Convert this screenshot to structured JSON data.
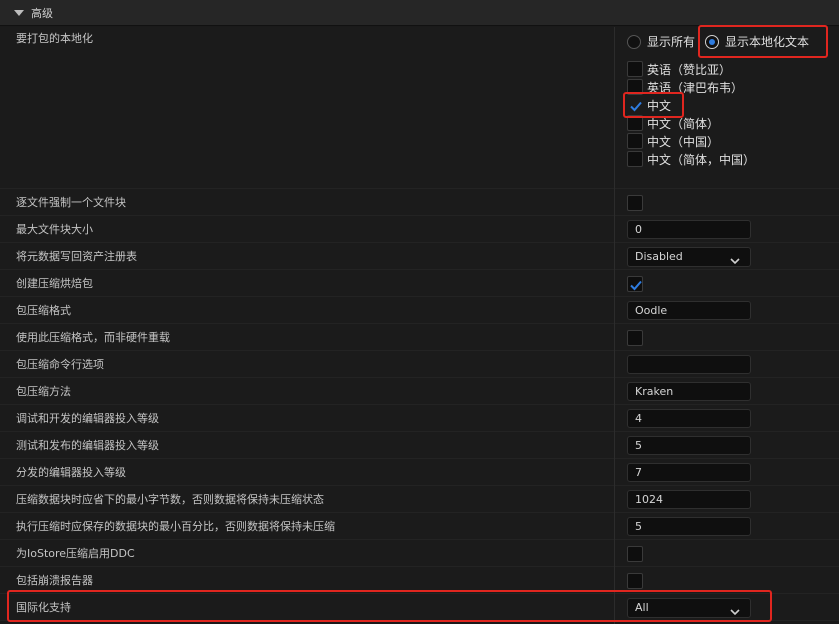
{
  "section": {
    "title": "高级"
  },
  "localization": {
    "label": "要打包的本地化",
    "radio_show_all": "显示所有",
    "radio_show_localized": "显示本地化文本",
    "selected_radio": "show_localized",
    "languages": [
      {
        "label": "英语（赞比亚）",
        "checked": false
      },
      {
        "label": "英语（津巴布韦）",
        "checked": false
      },
      {
        "label": "中文",
        "checked": true
      },
      {
        "label": "中文（简体）",
        "checked": false
      },
      {
        "label": "中文（中国）",
        "checked": false
      },
      {
        "label": "中文（简体，中国）",
        "checked": false
      }
    ]
  },
  "settings": [
    {
      "label": "逐文件强制一个文件块",
      "type": "checkbox",
      "checked": false
    },
    {
      "label": "最大文件块大小",
      "type": "text",
      "value": "0"
    },
    {
      "label": "将元数据写回资产注册表",
      "type": "dropdown",
      "value": "Disabled"
    },
    {
      "label": "创建压缩烘焙包",
      "type": "checkbox",
      "checked": true
    },
    {
      "label": "包压缩格式",
      "type": "text",
      "value": "Oodle"
    },
    {
      "label": "使用此压缩格式，而非硬件重载",
      "type": "checkbox",
      "checked": false
    },
    {
      "label": "包压缩命令行选项",
      "type": "text",
      "value": ""
    },
    {
      "label": "包压缩方法",
      "type": "text",
      "value": "Kraken"
    },
    {
      "label": "调试和开发的编辑器投入等级",
      "type": "text",
      "value": "4"
    },
    {
      "label": "测试和发布的编辑器投入等级",
      "type": "text",
      "value": "5"
    },
    {
      "label": "分发的编辑器投入等级",
      "type": "text",
      "value": "7"
    },
    {
      "label": "压缩数据块时应省下的最小字节数，否则数据将保持未压缩状态",
      "type": "text",
      "value": "1024"
    },
    {
      "label": "执行压缩时应保存的数据块的最小百分比，否则数据将保持未压缩",
      "type": "text",
      "value": "5"
    },
    {
      "label": "为IoStore压缩启用DDC",
      "type": "checkbox",
      "checked": false
    },
    {
      "label": "包括崩溃报告器",
      "type": "checkbox",
      "checked": false
    },
    {
      "label": "国际化支持",
      "type": "dropdown",
      "value": "All"
    }
  ],
  "colors": {
    "accent": "#2f7de1",
    "highlight": "#e0261f"
  }
}
